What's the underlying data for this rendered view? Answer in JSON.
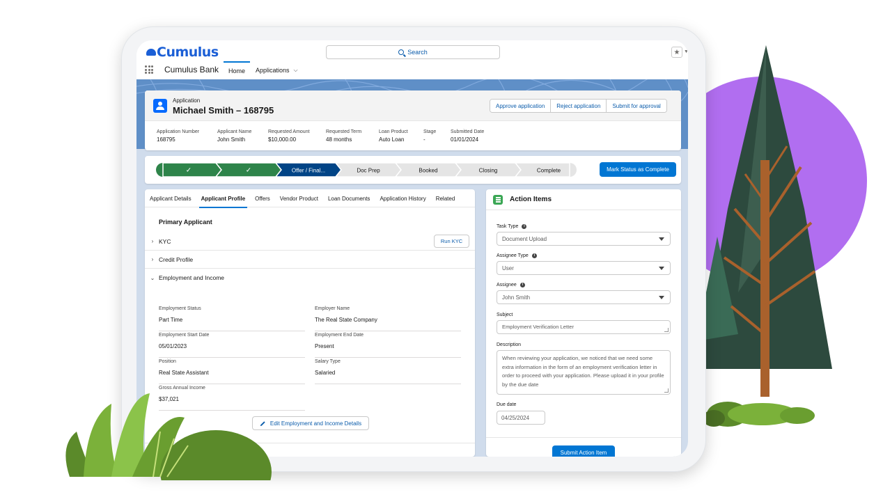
{
  "header": {
    "logo_text": "Cumulus",
    "search_placeholder": "Search",
    "app_name": "Cumulus Bank",
    "nav": [
      {
        "label": "Home"
      },
      {
        "label": "Applications"
      }
    ]
  },
  "record": {
    "object_label": "Application",
    "title": "Michael Smith – 168795",
    "actions": [
      "Approve application",
      "Reject application",
      "Submit for approval"
    ],
    "highlights": [
      {
        "label": "Application Number",
        "value": "168795"
      },
      {
        "label": "Applicant Name",
        "value": "John Smith"
      },
      {
        "label": "Requested Amount",
        "value": "$10,000.00"
      },
      {
        "label": "Requested Term",
        "value": "48 months"
      },
      {
        "label": "Loan Product",
        "value": "Auto Loan"
      },
      {
        "label": "Stage",
        "value": "-"
      },
      {
        "label": "Submitted Date",
        "value": "01/01/2024"
      }
    ]
  },
  "path": {
    "stages": [
      {
        "label": "✓",
        "state": "complete"
      },
      {
        "label": "✓",
        "state": "complete"
      },
      {
        "label": "Offer / Final...",
        "state": "current"
      },
      {
        "label": "Doc Prep",
        "state": "incomplete"
      },
      {
        "label": "Booked",
        "state": "incomplete"
      },
      {
        "label": "Closing",
        "state": "incomplete"
      },
      {
        "label": "Complete",
        "state": "incomplete"
      }
    ],
    "action": "Mark Status as Complete",
    "colors": {
      "complete": "#2e844a",
      "current": "#014486",
      "incomplete": "#e5e5e5"
    }
  },
  "tabs": [
    "Applicant Details",
    "Applicant Profile",
    "Offers",
    "Vendor Product",
    "Loan Documents",
    "Application History",
    "Related"
  ],
  "active_tab": "Applicant Profile",
  "profile": {
    "section_title": "Primary Applicant",
    "accordion": [
      "KYC",
      "Credit Profile",
      "Employment and Income"
    ],
    "run_kyc": "Run KYC",
    "fields": [
      {
        "label": "Employment Status",
        "value": "Part Time"
      },
      {
        "label": "Employer Name",
        "value": "The Real State Company"
      },
      {
        "label": "Employment Start Date",
        "value": "05/01/2023"
      },
      {
        "label": "Employment End Date",
        "value": "Present"
      },
      {
        "label": "Position",
        "value": "Real State Assistant"
      },
      {
        "label": "Salary Type",
        "value": "Salaried"
      },
      {
        "label": "Gross Annual Income",
        "value": "$37,021"
      }
    ],
    "edit_button": "Edit Employment and Income Details"
  },
  "action_items": {
    "title": "Action Items",
    "task_type_label": "Task Type",
    "task_type_value": "Document Upload",
    "assignee_type_label": "Assignee Type",
    "assignee_type_value": "User",
    "assignee_label": "Assignee",
    "assignee_value": "John Smith",
    "subject_label": "Subject",
    "subject_value": "Employment Verification Letter",
    "description_label": "Description",
    "description_value": "When reviewing your application, we noticed that we need some extra information in the form of an employment verification letter in order to proceed with your application. Please upload it in your profile by the due date",
    "due_date_label": "Due date",
    "due_date_value": "04/25/2024",
    "submit": "Submit Action Item"
  },
  "colors": {
    "brand": "#1b5fd6",
    "accent": "#0176d3",
    "purple": "#b16ef0"
  }
}
